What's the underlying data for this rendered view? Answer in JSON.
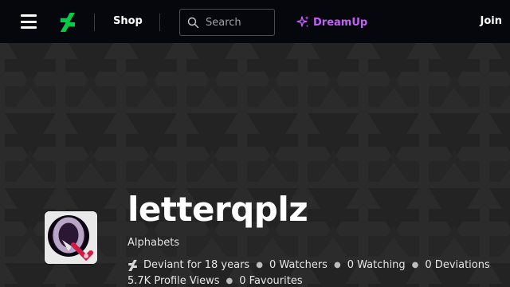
{
  "nav": {
    "shop_label": "Shop",
    "search_placeholder": "Search",
    "dreamup_label": "DreamUp",
    "join_label": "Join"
  },
  "profile": {
    "username": "letterqplz",
    "tagline": "Alphabets",
    "stats": {
      "member": "Deviant for 18 years",
      "watchers": "0 Watchers",
      "watching": "0 Watching",
      "deviations": "0 Deviations",
      "profile_views": "5.7K Profile Views",
      "favourites": "0 Favourites"
    }
  },
  "colors": {
    "nav_bg": "#06070d",
    "brand_green": "#05cc47",
    "dreamup_purple": "#c261f5",
    "banner_bg": "#2b2b2b"
  },
  "icons": {
    "menu": "hamburger-icon",
    "logo": "deviantart-logo",
    "search": "search-icon",
    "dreamup": "sparkle-icon"
  }
}
